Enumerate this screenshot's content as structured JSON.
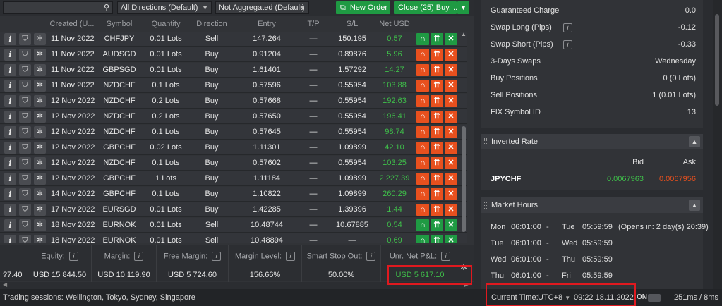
{
  "toolbar": {
    "direction_filter": "All Directions (Default)",
    "aggregation_filter": "Not Aggregated (Default)",
    "new_order_label": "New Order",
    "close_label": "Close (25) Buy, ..."
  },
  "grid": {
    "columns": [
      "Created (U...",
      "Symbol",
      "Quantity",
      "Direction",
      "Entry",
      "T/P",
      "S/L",
      "Net USD"
    ],
    "rows": [
      {
        "created": "11 Nov 2022 ...",
        "symbol": "CHFJPY",
        "quantity": "0.01 Lots",
        "direction": "Sell",
        "entry": "147.264",
        "tp": "—",
        "sl": "150.195",
        "net": "0.57"
      },
      {
        "created": "11 Nov 2022 ...",
        "symbol": "AUDSGD",
        "quantity": "0.01 Lots",
        "direction": "Buy",
        "entry": "0.91204",
        "tp": "—",
        "sl": "0.89876",
        "net": "5.96"
      },
      {
        "created": "11 Nov 2022 ...",
        "symbol": "GBPSGD",
        "quantity": "0.01 Lots",
        "direction": "Buy",
        "entry": "1.61401",
        "tp": "—",
        "sl": "1.57292",
        "net": "14.27"
      },
      {
        "created": "11 Nov 2022 ...",
        "symbol": "NZDCHF",
        "quantity": "0.1 Lots",
        "direction": "Buy",
        "entry": "0.57596",
        "tp": "—",
        "sl": "0.55954",
        "net": "103.88"
      },
      {
        "created": "12 Nov 2022 ...",
        "symbol": "NZDCHF",
        "quantity": "0.2 Lots",
        "direction": "Buy",
        "entry": "0.57668",
        "tp": "—",
        "sl": "0.55954",
        "net": "192.63"
      },
      {
        "created": "12 Nov 2022 ...",
        "symbol": "NZDCHF",
        "quantity": "0.2 Lots",
        "direction": "Buy",
        "entry": "0.57650",
        "tp": "—",
        "sl": "0.55954",
        "net": "196.41"
      },
      {
        "created": "12 Nov 2022 ...",
        "symbol": "NZDCHF",
        "quantity": "0.1 Lots",
        "direction": "Buy",
        "entry": "0.57645",
        "tp": "—",
        "sl": "0.55954",
        "net": "98.74"
      },
      {
        "created": "12 Nov 2022 ...",
        "symbol": "GBPCHF",
        "quantity": "0.02 Lots",
        "direction": "Buy",
        "entry": "1.11301",
        "tp": "—",
        "sl": "1.09899",
        "net": "42.10"
      },
      {
        "created": "12 Nov 2022 ...",
        "symbol": "NZDCHF",
        "quantity": "0.1 Lots",
        "direction": "Buy",
        "entry": "0.57602",
        "tp": "—",
        "sl": "0.55954",
        "net": "103.25"
      },
      {
        "created": "12 Nov 2022 ...",
        "symbol": "GBPCHF",
        "quantity": "1 Lots",
        "direction": "Buy",
        "entry": "1.11184",
        "tp": "—",
        "sl": "1.09899",
        "net": "2 227.39"
      },
      {
        "created": "14 Nov 2022 ...",
        "symbol": "GBPCHF",
        "quantity": "0.1 Lots",
        "direction": "Buy",
        "entry": "1.10822",
        "tp": "—",
        "sl": "1.09899",
        "net": "260.29"
      },
      {
        "created": "17 Nov 2022 ...",
        "symbol": "EURSGD",
        "quantity": "0.01 Lots",
        "direction": "Buy",
        "entry": "1.42285",
        "tp": "—",
        "sl": "1.39396",
        "net": "1.44"
      },
      {
        "created": "18 Nov 2022 ...",
        "symbol": "EURNOK",
        "quantity": "0.01 Lots",
        "direction": "Sell",
        "entry": "10.48744",
        "tp": "—",
        "sl": "10.67885",
        "net": "0.54"
      },
      {
        "created": "18 Nov 2022 ...",
        "symbol": "EURNOK",
        "quantity": "0.01 Lots",
        "direction": "Sell",
        "entry": "10.48894",
        "tp": "—",
        "sl": "—",
        "net": "0.69"
      }
    ]
  },
  "summary": {
    "balance_partial": "?7.40",
    "equity_label": "Equity:",
    "equity": "USD 15 844.50",
    "margin_label": "Margin:",
    "margin": "USD 10 119.90",
    "free_margin_label": "Free Margin:",
    "free_margin": "USD 5 724.60",
    "margin_level_label": "Margin Level:",
    "margin_level": "156.66%",
    "smart_stop_label": "Smart Stop Out:",
    "smart_stop": "50.00%",
    "unr_pnl_label": "Unr. Net P&L:",
    "unr_pnl": "USD 5 617.10"
  },
  "symbol_info": [
    {
      "key": "Guaranteed Charge",
      "value": "0.0"
    },
    {
      "key": "Swap Long (Pips)",
      "value": "-0.12",
      "info": true
    },
    {
      "key": "Swap Short (Pips)",
      "value": "-0.33",
      "info": true
    },
    {
      "key": "3-Days Swaps",
      "value": "Wednesday"
    },
    {
      "key": "Buy Positions",
      "value": "0 (0 Lots)"
    },
    {
      "key": "Sell Positions",
      "value": "1 (0.01 Lots)"
    },
    {
      "key": "FIX Symbol ID",
      "value": "13"
    }
  ],
  "inverted_rate": {
    "title": "Inverted Rate",
    "bid_label": "Bid",
    "ask_label": "Ask",
    "symbol": "JPYCHF",
    "bid": "0.0067963",
    "ask": "0.0067956"
  },
  "market_hours": {
    "title": "Market Hours",
    "rows": [
      {
        "d1": "Mon",
        "t1": "06:01:00",
        "sep": "-",
        "d2": "Tue",
        "t2": "05:59:59",
        "note": "(Opens in: 2 day(s) 20:39)"
      },
      {
        "d1": "Tue",
        "t1": "06:01:00",
        "sep": "-",
        "d2": "Wed",
        "t2": "05:59:59",
        "note": ""
      },
      {
        "d1": "Wed",
        "t1": "06:01:00",
        "sep": "-",
        "d2": "Thu",
        "t2": "05:59:59",
        "note": ""
      },
      {
        "d1": "Thu",
        "t1": "06:01:00",
        "sep": "-",
        "d2": "Fri",
        "t2": "05:59:59",
        "note": ""
      }
    ]
  },
  "status": {
    "sessions": "Trading sessions: Wellington, Tokyo, Sydney, Singapore",
    "current_time_label": "Current Time:",
    "timezone": "UTC+8",
    "datetime": "09:22 18.11.2022",
    "on_label": "ON",
    "latency": "251ms / 8ms"
  },
  "colors": {
    "accent_green": "#1f9a43",
    "accent_orange": "#e8501e",
    "profit_green": "#3fbf4a",
    "highlight_red": "#e0191f"
  }
}
